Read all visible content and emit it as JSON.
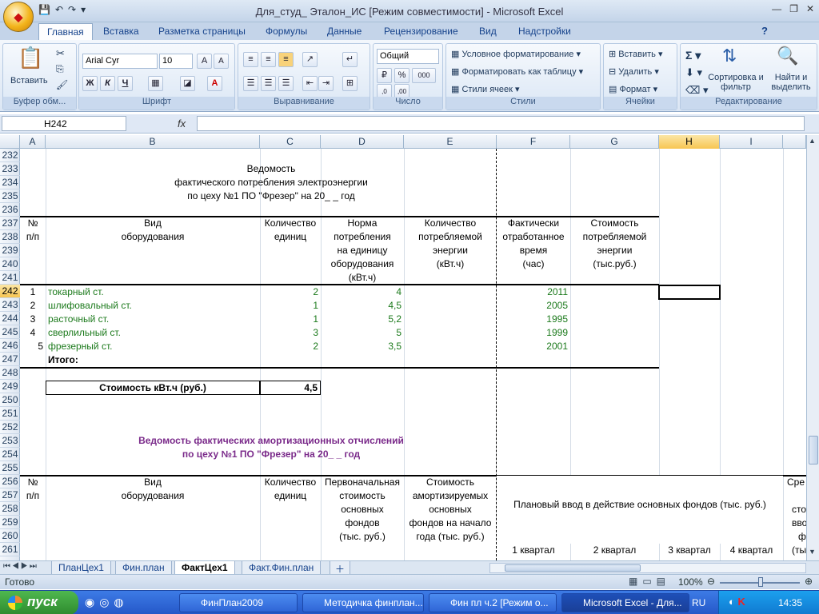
{
  "window": {
    "title": "Для_студ_ Эталон_ИС  [Режим совместимости] - Microsoft Excel"
  },
  "ribbon_tabs": [
    "Главная",
    "Вставка",
    "Разметка страницы",
    "Формулы",
    "Данные",
    "Рецензирование",
    "Вид",
    "Надстройки"
  ],
  "ribbon": {
    "paste": "Вставить",
    "clipboard": "Буфер обм...",
    "font_name": "Arial Cyr",
    "font_size": "10",
    "font_group": "Шрифт",
    "bold": "Ж",
    "italic": "К",
    "underline": "Ч",
    "align_group": "Выравнивание",
    "number_format": "Общий",
    "number_group": "Число",
    "cond_format": "Условное форматирование",
    "format_table": "Форматировать как таблицу",
    "cell_styles": "Стили ячеек",
    "styles_group": "Стили",
    "insert": "Вставить",
    "delete": "Удалить",
    "format": "Формат",
    "cells_group": "Ячейки",
    "sort": "Сортировка и фильтр",
    "find": "Найти и выделить",
    "edit_group": "Редактирование"
  },
  "formula_bar": {
    "name_box": "H242",
    "fx": "fx",
    "formula": ""
  },
  "columns": [
    "A",
    "B",
    "C",
    "D",
    "E",
    "F",
    "G",
    "H",
    "I"
  ],
  "rows": [
    "232",
    "233",
    "234",
    "235",
    "236",
    "237",
    "238",
    "239",
    "240",
    "241",
    "242",
    "243",
    "244",
    "245",
    "246",
    "247",
    "248",
    "249",
    "250",
    "251",
    "252",
    "253",
    "254",
    "255",
    "256",
    "257",
    "258",
    "259",
    "260",
    "261"
  ],
  "table1": {
    "title1": "Ведомость",
    "title2": "фактического потребления электроэнергии",
    "title3": "по цеху №1 ПО \"Фрезер\" на 20_ _   год",
    "h_no": [
      "№",
      "п/п"
    ],
    "h_type": [
      "Вид",
      "оборудования"
    ],
    "h_qty": [
      "Количество",
      "единиц"
    ],
    "h_norm": [
      "Норма",
      "потребления",
      "на единицу",
      "оборудования",
      "(кВт.ч)"
    ],
    "h_energy": [
      "Количество",
      "потребляемой",
      "энергии",
      "(кВт.ч)"
    ],
    "h_time": [
      "Фактически",
      "отработанное",
      "время",
      "(час)"
    ],
    "h_cost": [
      "Стоимость",
      "потребляемой",
      "энергии",
      "(тыс.руб.)"
    ],
    "rows": [
      {
        "no": "1",
        "name": "токарный ст.",
        "qty": "2",
        "norm": "4",
        "time": "2011"
      },
      {
        "no": "2",
        "name": "шлифовальный ст.",
        "qty": "1",
        "norm": "4,5",
        "time": "2005"
      },
      {
        "no": "3",
        "name": "расточный ст.",
        "qty": "1",
        "norm": "5,2",
        "time": "1995"
      },
      {
        "no": "4",
        "name": "сверлильный ст.",
        "qty": "3",
        "norm": "5",
        "time": "1999"
      },
      {
        "no": "5",
        "name": "фрезерный ст.",
        "qty": "2",
        "norm": "3,5",
        "time": "2001"
      }
    ],
    "total": "Итого:",
    "cost_label": "Стоимость кВт.ч (руб.)",
    "cost_value": "4,5"
  },
  "table2": {
    "title1": "Ведомость фактических амортизационных отчислений",
    "title2": "по цеху №1 ПО \"Фрезер\" на 20_ _   год",
    "h_no": [
      "№",
      "п/п"
    ],
    "h_type": [
      "Вид",
      "оборудования"
    ],
    "h_qty": [
      "Количество",
      "единиц"
    ],
    "h_init": [
      "Первоначальная",
      "стоимость",
      "основных",
      "фондов",
      "(тыс. руб.)"
    ],
    "h_amort": [
      "Стоимость",
      "амортизируемых",
      "основных",
      "фондов на начало",
      "года (тыс. руб.)"
    ],
    "h_plan": "Плановый ввод в действие основных фондов        (тыс. руб.)",
    "quarters": [
      "1 квартал",
      "2 квартал",
      "3 квартал",
      "4 квартал"
    ],
    "h_avg": [
      "Сре",
      "сто",
      "вво",
      "ф",
      "(ты"
    ]
  },
  "sheets": [
    "ПланЦех1",
    "Фин.план",
    "ФактЦех1",
    "Факт.Фин.план"
  ],
  "status": {
    "ready": "Готово",
    "zoom": "100%"
  },
  "taskbar": {
    "start": "пуск",
    "items": [
      "ФинПлан2009",
      "Методичка финплан...",
      "Фин пл ч.2 [Режим о...",
      "Microsoft Excel - Для..."
    ],
    "lang": "RU",
    "time": "14:35"
  }
}
